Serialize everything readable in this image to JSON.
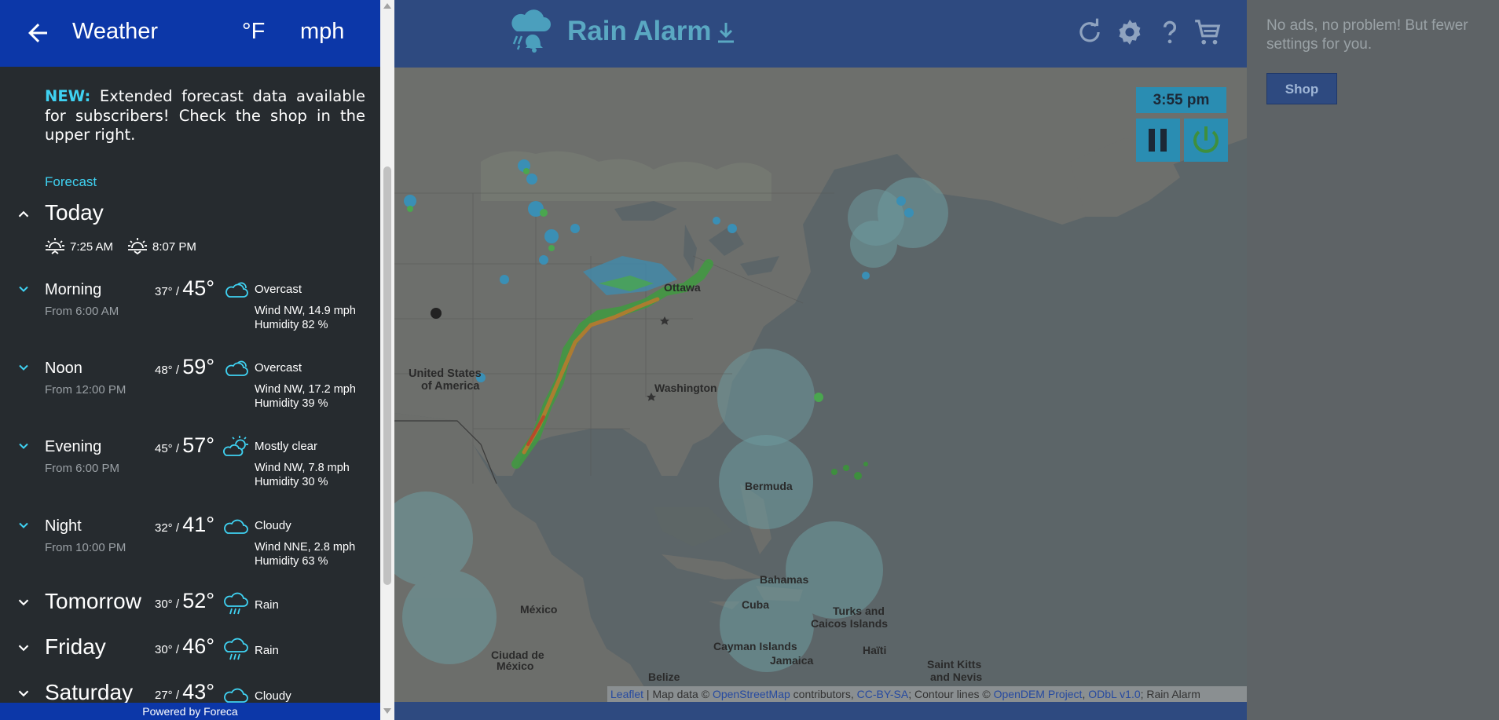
{
  "header": {
    "title": "Weather",
    "unit_temp": "°F",
    "unit_speed": "mph"
  },
  "notice": {
    "badge": "NEW:",
    "text": " Extended forecast data available for subscribers! Check the shop in the upper right."
  },
  "forecast_label": "Forecast",
  "today": {
    "name": "Today",
    "sunrise": "7:25 AM",
    "sunset": "8:07 PM",
    "periods": [
      {
        "name": "Morning",
        "from": "From 6:00 AM",
        "lo": "37° / ",
        "hi": "45°",
        "icon": "overcast-icon",
        "desc": "Overcast",
        "wind": "Wind NW, 14.9 mph",
        "humidity": "Humidity 82 %"
      },
      {
        "name": "Noon",
        "from": "From 12:00 PM",
        "lo": "48° / ",
        "hi": "59°",
        "icon": "overcast-icon",
        "desc": "Overcast",
        "wind": "Wind NW, 17.2 mph",
        "humidity": "Humidity 39 %"
      },
      {
        "name": "Evening",
        "from": "From 6:00 PM",
        "lo": "45° / ",
        "hi": "57°",
        "icon": "mostly-clear-icon",
        "desc": "Mostly clear",
        "wind": "Wind NW, 7.8 mph",
        "humidity": "Humidity 30 %"
      },
      {
        "name": "Night",
        "from": "From 10:00 PM",
        "lo": "32° / ",
        "hi": "41°",
        "icon": "cloudy-icon",
        "desc": "Cloudy",
        "wind": "Wind NNE, 2.8 mph",
        "humidity": "Humidity 63 %"
      }
    ]
  },
  "days": [
    {
      "name": "Tomorrow",
      "lo": "30° / ",
      "hi": "52°",
      "icon": "rain-icon",
      "desc": "Rain"
    },
    {
      "name": "Friday",
      "lo": "30° / ",
      "hi": "46°",
      "icon": "rain-icon",
      "desc": "Rain"
    },
    {
      "name": "Saturday",
      "lo": "27° / ",
      "hi": "43°",
      "icon": "cloudy-icon",
      "desc": "Cloudy"
    }
  ],
  "powered_by": "Powered by Foreca",
  "app": {
    "title": "Rain Alarm",
    "time": "3:55 pm"
  },
  "map_labels": {
    "ottawa": "Ottawa",
    "washington": "Washington",
    "usa_1": "United States",
    "usa_2": "of America",
    "bermuda": "Bermuda",
    "bahamas": "Bahamas",
    "cuba": "Cuba",
    "mexico": "México",
    "mexico_city_1": "Ciudad de",
    "mexico_city_2": "México",
    "turks_1": "Turks and",
    "turks_2": "Caicos Islands",
    "cayman": "Cayman Islands",
    "jamaica": "Jamaica",
    "haiti": "Haïti",
    "stkitts_1": "Saint Kitts",
    "stkitts_2": "and Nevis",
    "belize": "Belize"
  },
  "attribution": {
    "leaflet": "Leaflet",
    "sep1": " | Map data © ",
    "osm": "OpenStreetMap",
    "sep2": " contributors, ",
    "ccbysa": "CC-BY-SA",
    "sep3": "; Contour lines © ",
    "opendem": "OpenDEM Project",
    "sep4": ", ",
    "odbl": "ODbL v1.0",
    "sep5": "; Rain Alarm"
  },
  "right_panel": {
    "message": "No ads, no problem! But fewer settings for you.",
    "shop_label": "Shop"
  },
  "colors": {
    "header_blue": "#0c37a8",
    "accent_cyan": "#3fd2f2",
    "panel_bg": "#262b2f",
    "topbar": "#2e4a80",
    "control_teal": "#2a8db2"
  }
}
